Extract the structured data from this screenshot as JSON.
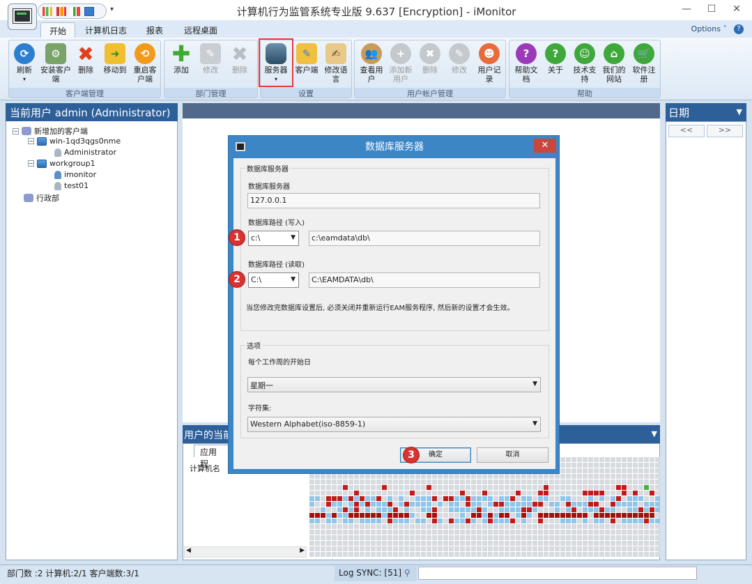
{
  "window": {
    "title": "计算机行为监管系统专业版 9.637 [Encryption] - iMonitor",
    "controls": {
      "minimize": "—",
      "maximize": "☐",
      "close": "✕"
    }
  },
  "ribbon": {
    "tabs": [
      "开始",
      "计算机日志",
      "报表",
      "远程桌面"
    ],
    "options_label": "Options",
    "options_arrow": "ˇ",
    "help_label": "?",
    "groups": [
      {
        "label": "客户端管理",
        "buttons": [
          "刷新",
          "安装客户端",
          "删除",
          "移动到",
          "重启客户端"
        ]
      },
      {
        "label": "部门管理",
        "buttons": [
          "添加",
          "修改",
          "删除"
        ]
      },
      {
        "label": "设置",
        "buttons": [
          "服务器",
          "客户端",
          "修改语言"
        ]
      },
      {
        "label": "用户帐户管理",
        "buttons": [
          "查看用户",
          "添加新用户",
          "删除",
          "修改",
          "用户记录"
        ]
      },
      {
        "label": "帮助",
        "buttons": [
          "帮助文档",
          "关于",
          "技术支持",
          "我们的网站",
          "软件注册"
        ]
      }
    ]
  },
  "left_panel": {
    "header": "当前用户 admin (Administrator)",
    "tree": [
      {
        "label": "新增加的客户端"
      },
      {
        "label": "win-1qd3qgs0nme"
      },
      {
        "label": "Administrator"
      },
      {
        "label": "workgroup1"
      },
      {
        "label": "imonitor"
      },
      {
        "label": "test01"
      },
      {
        "label": "行政部"
      }
    ]
  },
  "right_panel": {
    "header": "日期",
    "prev": "<<",
    "next": ">>"
  },
  "bottom_panel": {
    "header": "用户的当前",
    "tab": "应用程",
    "column": "计算机名"
  },
  "status": {
    "dept_count": "部门数 :2",
    "computers": "计算机:2/1",
    "clients": "客户端数:3/1",
    "log": "Log SYNC: [51]"
  },
  "dialog": {
    "title": "数据库服务器",
    "close": "✕",
    "group1_title": "数据库服务器",
    "server_label": "数据库服务器",
    "server_value": "127.0.0.1",
    "write_label": "数据库路径 (写入)",
    "write_drive": "c:\\",
    "write_path": "c:\\eamdata\\db\\",
    "read_label": "数据库路径 (读取)",
    "read_drive": "C:\\",
    "read_path": "C:\\EAMDATA\\db\\",
    "note": "当您修改完数据库设置后, 必须关闭并重新运行EAM服务程序, 然后新的设置才会生效。",
    "group2_title": "选项",
    "weekday_label": "每个工作周的开始日",
    "weekday_value": "星期一",
    "charset_label": "字符集:",
    "charset_value": "Western Alphabet(iso-8859-1)",
    "ok": "确定",
    "cancel": "取消"
  },
  "annotations": [
    "1",
    "2",
    "3"
  ],
  "colors": {
    "accent": "#2d5f99",
    "dialog": "#3c86c6",
    "highlight": "#e23a3a",
    "badge": "#d9322f"
  }
}
